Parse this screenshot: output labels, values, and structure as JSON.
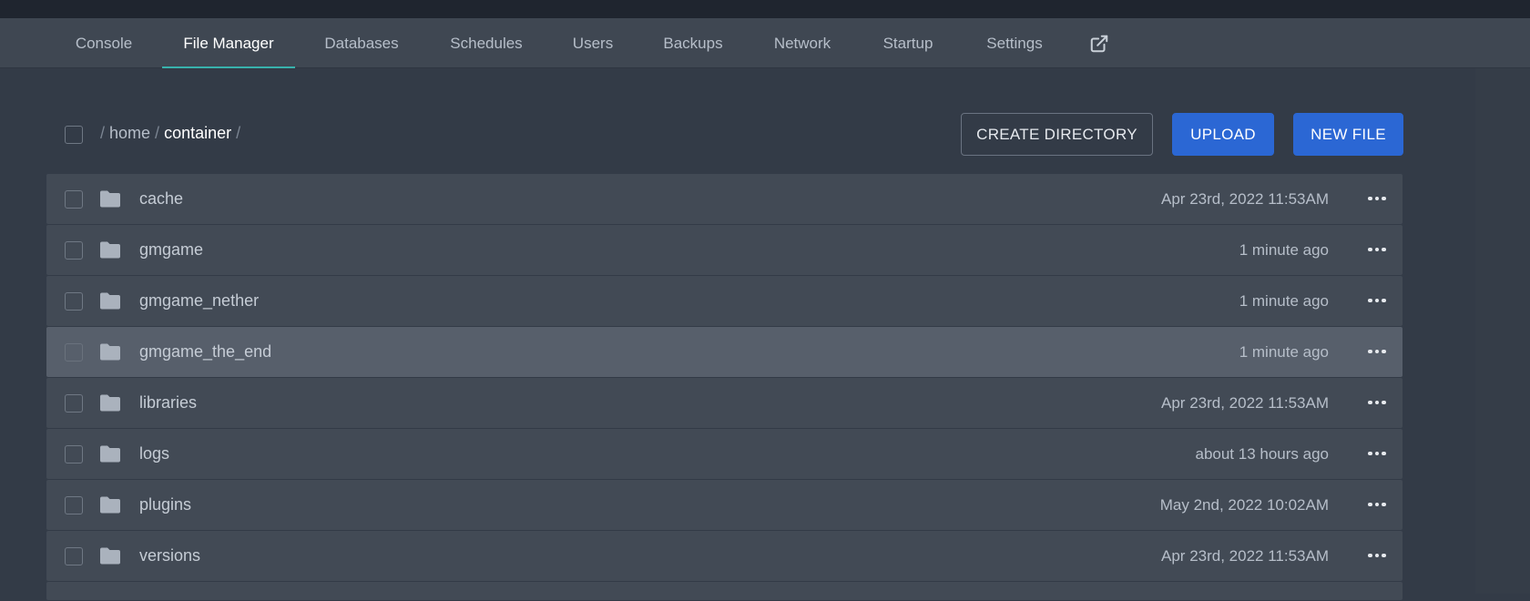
{
  "tabs": [
    {
      "label": "Console",
      "active": false
    },
    {
      "label": "File Manager",
      "active": true
    },
    {
      "label": "Databases",
      "active": false
    },
    {
      "label": "Schedules",
      "active": false
    },
    {
      "label": "Users",
      "active": false
    },
    {
      "label": "Backups",
      "active": false
    },
    {
      "label": "Network",
      "active": false
    },
    {
      "label": "Startup",
      "active": false
    },
    {
      "label": "Settings",
      "active": false
    }
  ],
  "external_link_icon": "external-link-icon",
  "breadcrumb": {
    "separator": "/",
    "parts": [
      "home",
      "container"
    ]
  },
  "buttons": {
    "create_directory": "CREATE DIRECTORY",
    "upload": "UPLOAD",
    "new_file": "NEW FILE"
  },
  "files": [
    {
      "name": "cache",
      "modified": "Apr 23rd, 2022 11:53AM",
      "type": "folder"
    },
    {
      "name": "gmgame",
      "modified": "1 minute ago",
      "type": "folder"
    },
    {
      "name": "gmgame_nether",
      "modified": "1 minute ago",
      "type": "folder"
    },
    {
      "name": "gmgame_the_end",
      "modified": "1 minute ago",
      "type": "folder",
      "hovered": true
    },
    {
      "name": "libraries",
      "modified": "Apr 23rd, 2022 11:53AM",
      "type": "folder"
    },
    {
      "name": "logs",
      "modified": "about 13 hours ago",
      "type": "folder"
    },
    {
      "name": "plugins",
      "modified": "May 2nd, 2022 10:02AM",
      "type": "folder"
    },
    {
      "name": "versions",
      "modified": "Apr 23rd, 2022 11:53AM",
      "type": "folder"
    }
  ],
  "colors": {
    "accent": "#38b2ac",
    "primary_button": "#2b67d4",
    "row_bg": "#424a55",
    "row_hover_bg": "#575f6b",
    "page_bg": "#333b47"
  }
}
